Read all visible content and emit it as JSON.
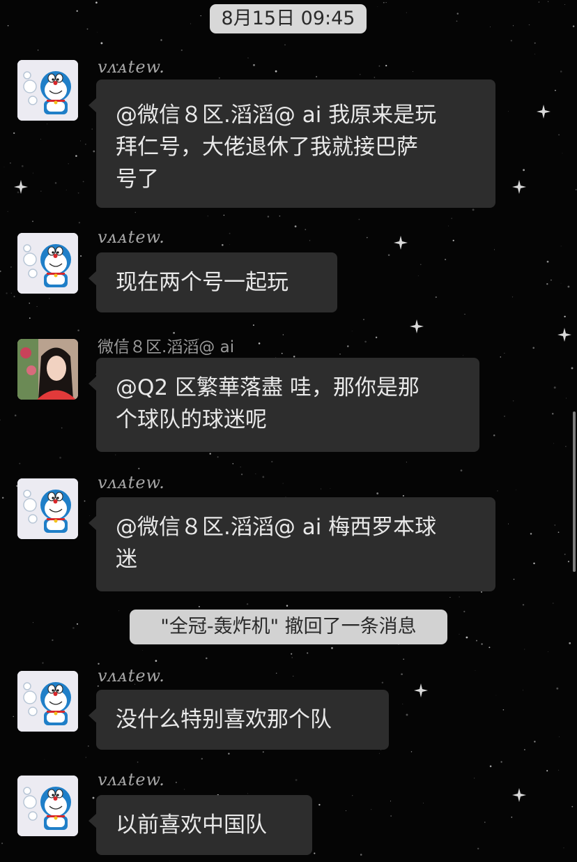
{
  "timestamp": "8月15日 09:45",
  "messages": [
    {
      "sender": "v̲̲̲atew.",
      "sender_display": "ⅴᴧᴀtew.",
      "text": "@微信８区.滔滔@ ai 我原来是玩\n拜仁号，大佬退休了我就接巴萨\n号了",
      "avatar": "doraemon-bubbles"
    },
    {
      "sender_display": "ⅴᴧᴀtew.",
      "text": "现在两个号一起玩",
      "avatar": "doraemon-bubbles"
    },
    {
      "sender_display": "微信８区.滔滔@ ai",
      "text": "@Q2 区繁華落盡 哇，那你是那\n个球队的球迷呢",
      "avatar": "woman-photo"
    },
    {
      "sender_display": "ⅴᴧᴀtew.",
      "text": "@微信８区.滔滔@ ai 梅西罗本球\n迷",
      "avatar": "doraemon-bubbles"
    },
    {
      "sender_display": "ⅴᴧᴀtew.",
      "text": "没什么特别喜欢那个队",
      "avatar": "doraemon-bubbles"
    },
    {
      "sender_display": "ⅴᴧᴀtew.",
      "text": "以前喜欢中国队",
      "avatar": "doraemon-bubbles"
    }
  ],
  "system_notice": "\"全冠-轰炸机\" 撤回了一条消息",
  "colors": {
    "background": "#050505",
    "bubble": "#2d2d2d",
    "pill": "#d8d8d8",
    "text": "#e9e9e9"
  }
}
